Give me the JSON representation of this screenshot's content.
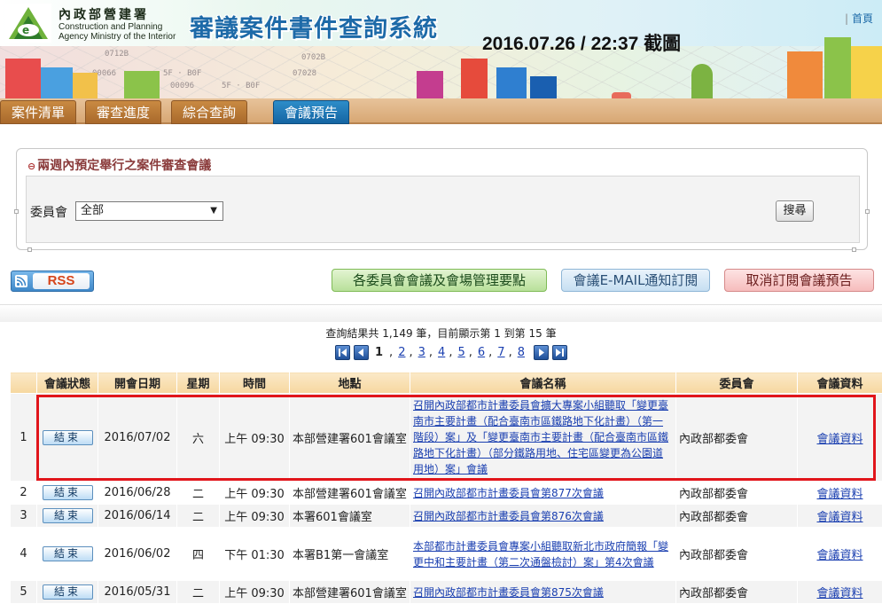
{
  "header": {
    "org_cn": "內政部營建署",
    "org_en_line1": "Construction and Planning",
    "org_en_line2": "Agency Ministry of the Interior",
    "system_title": "審議案件書件查詢系統",
    "timestamp_caption": "2016.07.26 / 22:37 截圖",
    "home_label": "首頁",
    "map_labels": [
      "0712B",
      "0702B",
      "00066",
      "5F · B0F",
      "07028",
      "00096",
      "5F · B0F"
    ]
  },
  "tabs": [
    {
      "label": "案件清單",
      "active": false
    },
    {
      "label": "審查進度",
      "active": false
    },
    {
      "label": "綜合查詢",
      "active": false
    },
    {
      "label": "會議預告",
      "active": true
    }
  ],
  "search_panel": {
    "title": "兩週內預定舉行之案件審查會議",
    "committee_label": "委員會",
    "committee_value": "全部",
    "search_button": "搜尋"
  },
  "actions": {
    "rss_label": "RSS",
    "rules_button": "各委員會會議及會場管理要點",
    "email_button": "會議E-MAIL通知訂閱",
    "unsubscribe_button": "取消訂閱會議預告"
  },
  "pagination": {
    "summary": "查詢結果共 1,149 筆，目前顯示第 1 到第 15 筆",
    "current_page": "1",
    "pages": [
      "2",
      "3",
      "4",
      "5",
      "6",
      "7",
      "8"
    ]
  },
  "table": {
    "headers": [
      "會議狀態",
      "開會日期",
      "星期",
      "時間",
      "地點",
      "會議名稱",
      "委員會",
      "會議資料"
    ],
    "rows": [
      {
        "no": "1",
        "status": "結束",
        "date": "2016/07/02",
        "weekday": "六",
        "time": "上午 09:30",
        "place": "本部營建署601會議室",
        "name": "召開內政部都市計畫委員會擴大專案小組聽取「變更臺南市主要計畫（配合臺南市區鐵路地下化計畫）（第一階段）案」及「變更臺南市主要計畫（配合臺南市區鐵路地下化計畫）（部分鐵路用地、住宅區變更為公園道用地）案」會議",
        "committee": "內政部都委會",
        "docs": "會議資料"
      },
      {
        "no": "2",
        "status": "結束",
        "date": "2016/06/28",
        "weekday": "二",
        "time": "上午 09:30",
        "place": "本部營建署601會議室",
        "name": "召開內政部都市計畫委員會第877次會議",
        "committee": "內政部都委會",
        "docs": "會議資料"
      },
      {
        "no": "3",
        "status": "結束",
        "date": "2016/06/14",
        "weekday": "二",
        "time": "上午 09:30",
        "place": "本署601會議室",
        "name": "召開內政部都市計畫委員會第876次會議",
        "committee": "內政部都委會",
        "docs": "會議資料"
      },
      {
        "no": "4",
        "status": "結束",
        "date": "2016/06/02",
        "weekday": "四",
        "time": "下午 01:30",
        "place": "本署B1第一會議室",
        "name": "本部都市計畫委員會專案小組聽取新北市政府簡報「變更中和主要計畫（第二次通盤檢討）案」第4次會議",
        "committee": "內政部都委會",
        "docs": "會議資料"
      },
      {
        "no": "5",
        "status": "結束",
        "date": "2016/05/31",
        "weekday": "二",
        "time": "上午 09:30",
        "place": "本部營建署601會議室",
        "name": "召開內政部都市計畫委員會第875次會議",
        "committee": "內政部都委會",
        "docs": "會議資料"
      }
    ]
  },
  "colors": {
    "title_blue": "#1d6aa8",
    "tab_active": "#1565a3",
    "tab_inactive": "#a9692b",
    "highlight_red": "#e1151b",
    "link_blue": "#1a3fb0"
  }
}
